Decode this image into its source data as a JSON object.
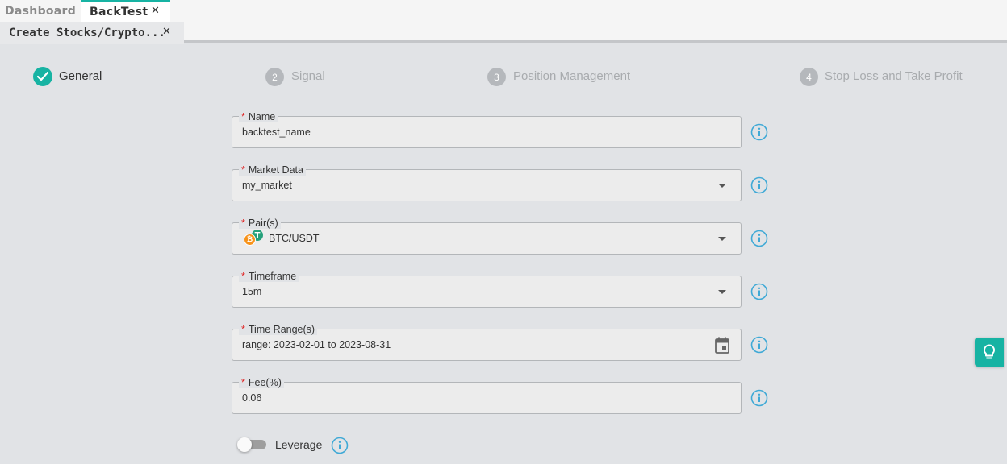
{
  "tabs": {
    "dashboard": "Dashboard",
    "backtest": "BackTest",
    "close_glyph": "✕"
  },
  "subtab": {
    "label": "Create Stocks/Crypto...",
    "close_glyph": "✕"
  },
  "steps": [
    {
      "number": "",
      "label": "General",
      "state": "done"
    },
    {
      "number": "2",
      "label": "Signal",
      "state": "pending"
    },
    {
      "number": "3",
      "label": "Position Management",
      "state": "pending"
    },
    {
      "number": "4",
      "label": "Stop Loss and Take Profit",
      "state": "pending"
    }
  ],
  "form": {
    "required_mark": "*",
    "name": {
      "label": "Name",
      "value": "backtest_name"
    },
    "market_data": {
      "label": "Market Data",
      "value": "my_market"
    },
    "pairs": {
      "label": "Pair(s)",
      "value": "BTC/USDT",
      "icons": [
        "btc-coin-icon",
        "usdt-coin-icon"
      ]
    },
    "timeframe": {
      "label": "Timeframe",
      "value": "15m"
    },
    "time_range": {
      "label": "Time Range(s)",
      "value": "range: 2023-02-01 to 2023-08-31"
    },
    "fee": {
      "label": "Fee(%)",
      "value": "0.06"
    },
    "leverage": {
      "label": "Leverage",
      "enabled": false
    }
  },
  "colors": {
    "accent": "#17b3a3",
    "required": "#e02424",
    "info": "#3fa9d6",
    "background": "#e1e3e6"
  }
}
